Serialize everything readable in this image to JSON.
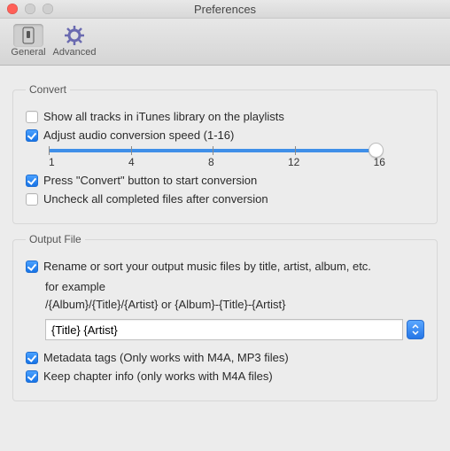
{
  "window": {
    "title": "Preferences"
  },
  "toolbar": {
    "general": "General",
    "advanced": "Advanced"
  },
  "convert": {
    "section": "Convert",
    "show_all": "Show all tracks in iTunes library on the playlists",
    "adjust_speed": "Adjust audio conversion speed (1-16)",
    "slider": {
      "min": "1",
      "t4": "4",
      "t8": "8",
      "t12": "12",
      "max": "16"
    },
    "press_convert": "Press \"Convert\" button to start conversion",
    "uncheck_all": "Uncheck all completed files after conversion"
  },
  "output": {
    "section": "Output File",
    "rename": "Rename or sort your output music files by title, artist, album, etc.",
    "for_example": "for example",
    "example_pattern": "/{Album}/{Title}/{Artist} or {Album}-{Title}-{Artist}",
    "pattern_value": "{Title} {Artist}",
    "metadata": "Metadata tags (Only works with M4A, MP3 files)",
    "chapter": "Keep chapter info (only works with  M4A files)"
  }
}
